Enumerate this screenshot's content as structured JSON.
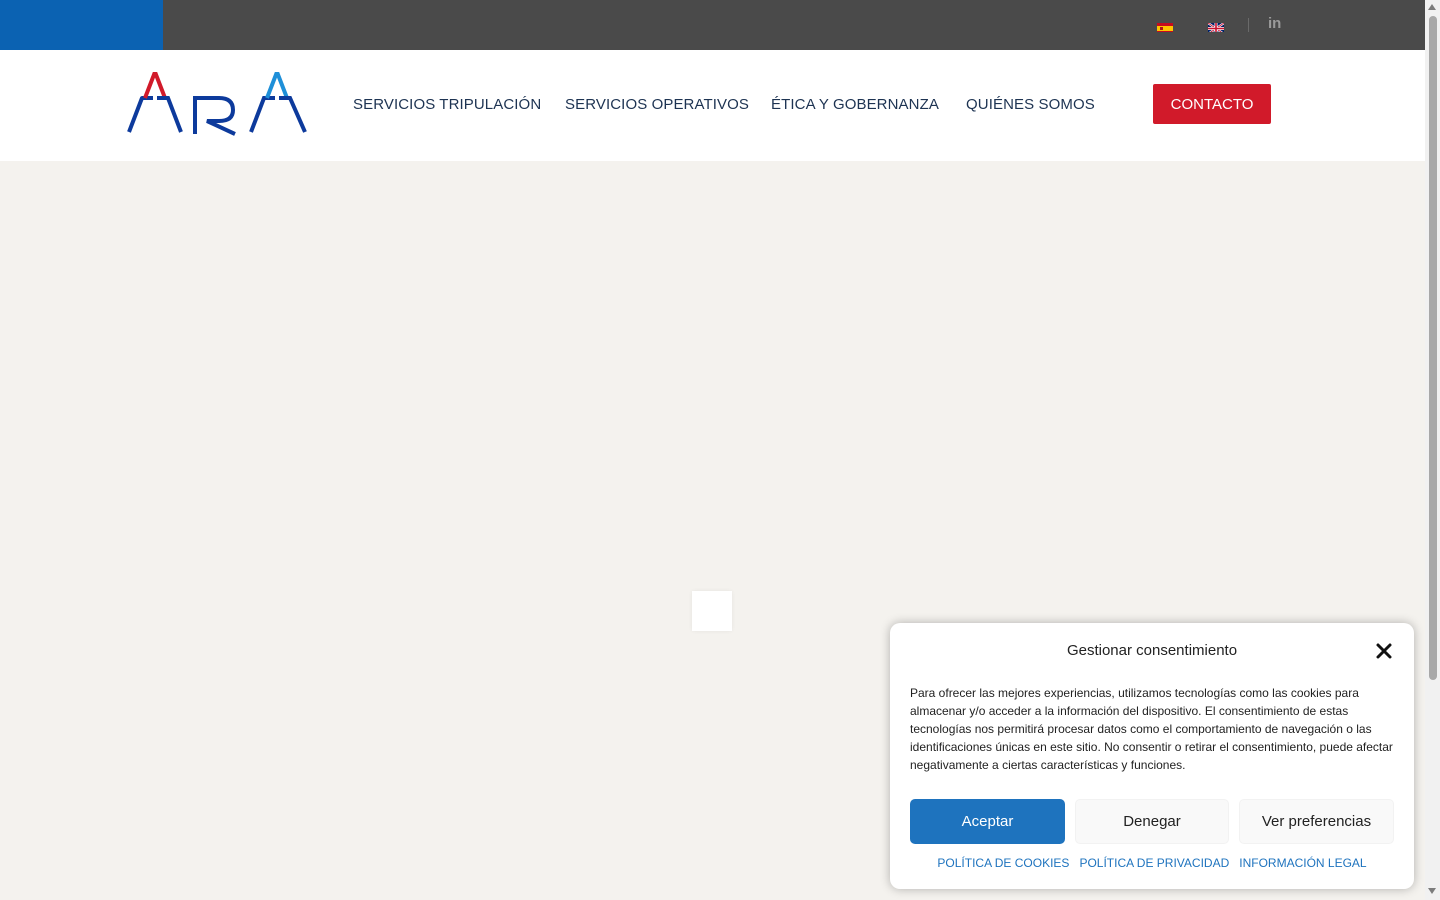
{
  "topbar": {
    "flags": [
      {
        "name": "es",
        "label": "Español"
      },
      {
        "name": "en",
        "label": "English"
      }
    ],
    "linkedin_label": "in"
  },
  "brand": {
    "logo_text": "ARA",
    "colors": {
      "dark_blue": "#0d3a9c",
      "red": "#d11a2a",
      "light_blue": "#1e8fd8"
    }
  },
  "nav": {
    "items": [
      {
        "label": "SERVICIOS TRIPULACIÓN"
      },
      {
        "label": "SERVICIOS OPERATIVOS"
      },
      {
        "label": "ÉTICA Y GOBERNANZA"
      },
      {
        "label": "QUIÉNES SOMOS"
      }
    ],
    "contact_label": "CONTACTO"
  },
  "cookie": {
    "title": "Gestionar consentimiento",
    "body": "Para ofrecer las mejores experiencias, utilizamos tecnologías como las cookies para almacenar y/o acceder a la información del dispositivo. El consentimiento de estas tecnologías nos permitirá procesar datos como el comportamiento de navegación o las identificaciones únicas en este sitio. No consentir o retirar el consentimiento, puede afectar negativamente a ciertas características y funciones.",
    "accept_label": "Aceptar",
    "deny_label": "Denegar",
    "prefs_label": "Ver preferencias",
    "links": [
      {
        "label": "POLÍTICA DE COOKIES"
      },
      {
        "label": "POLÍTICA DE PRIVACIDAD"
      },
      {
        "label": "INFORMACIÓN LEGAL"
      }
    ]
  },
  "colors": {
    "topbar_bg": "#4a4a4a",
    "topbar_accent": "#0b62b2",
    "page_bg": "#f4f2ee",
    "nav_text": "#1d3352",
    "contact_bg": "#d11a2a",
    "accept_bg": "#1e73be"
  }
}
